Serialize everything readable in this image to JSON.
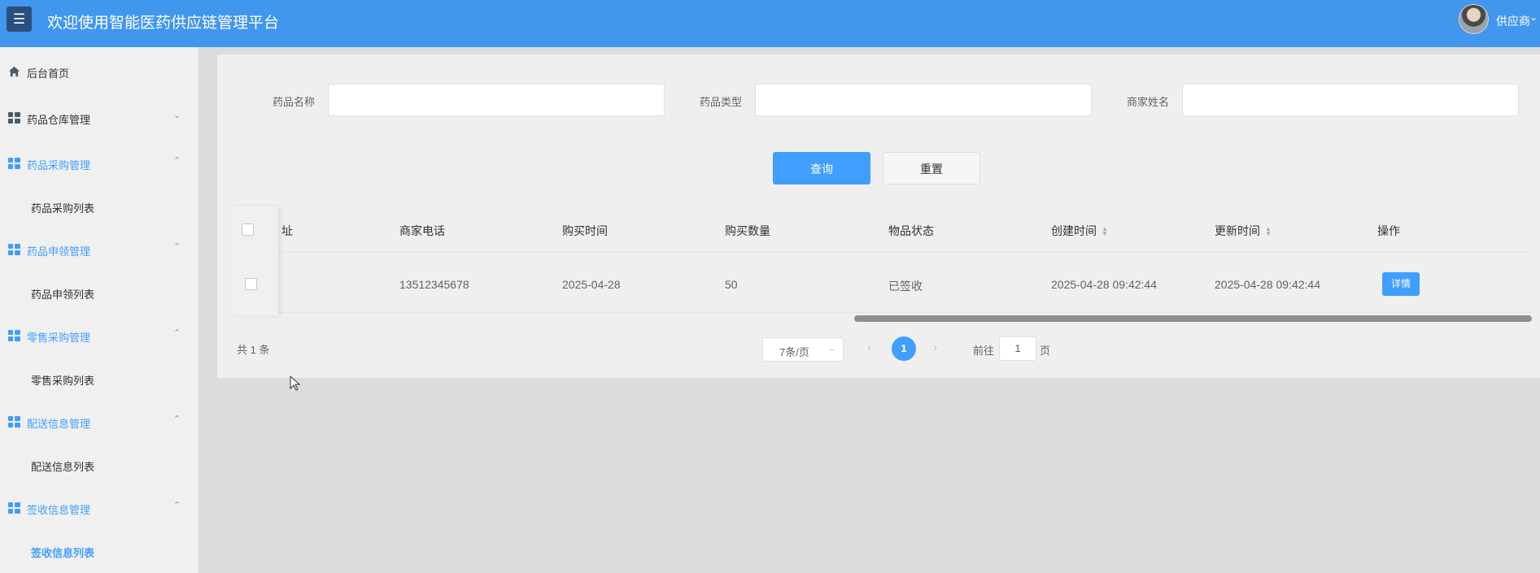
{
  "header": {
    "menu_icon": "hamburger-icon",
    "title": "欢迎使用智能医药供应链管理平台",
    "user_name": "供应商",
    "user_caret": "⌄"
  },
  "sidebar": {
    "home": "后台首页",
    "groups": [
      {
        "label": "药品仓库管理",
        "caret": "⌄",
        "expanded": false
      },
      {
        "label": "药品采购管理",
        "caret": "⌃",
        "expanded": true,
        "child": "药品采购列表"
      },
      {
        "label": "药品申领管理",
        "caret": "⌃",
        "expanded": true,
        "child": "药品申领列表"
      },
      {
        "label": "零售采购管理",
        "caret": "⌃",
        "expanded": true,
        "child": "零售采购列表"
      },
      {
        "label": "配送信息管理",
        "caret": "⌃",
        "expanded": true,
        "child": "配送信息列表"
      },
      {
        "label": "签收信息管理",
        "caret": "⌃",
        "expanded": true,
        "child": "签收信息列表",
        "active_child": true
      }
    ]
  },
  "search": {
    "drug_name_label": "药品名称",
    "drug_name_value": "",
    "drug_type_label": "药品类型",
    "drug_type_value": "",
    "merchant_name_label": "商家姓名",
    "merchant_name_value": "",
    "query_button": "查询",
    "reset_button": "重置"
  },
  "table": {
    "columns": {
      "partial_address": "址",
      "merchant_phone": "商家电话",
      "purchase_time": "购买时间",
      "purchase_quantity": "购买数量",
      "item_status": "物品状态",
      "created_at": "创建时间",
      "updated_at": "更新时间",
      "actions": "操作"
    },
    "rows": [
      {
        "merchant_phone": "13512345678",
        "purchase_time": "2025-04-28",
        "purchase_quantity": "50",
        "item_status": "已签收",
        "created_at": "2025-04-28 09:42:44",
        "updated_at": "2025-04-28 09:42:44",
        "action": "详情"
      }
    ]
  },
  "pagination": {
    "total": "共 1 条",
    "page_size": "7条/页",
    "prev": "‹",
    "current_page": "1",
    "next": "›",
    "goto_prefix": "前往",
    "goto_value": "1",
    "goto_suffix": "页"
  },
  "colors": {
    "header": "#4196ee",
    "primary": "#409eff",
    "sidebar": "#f0f0f0"
  }
}
